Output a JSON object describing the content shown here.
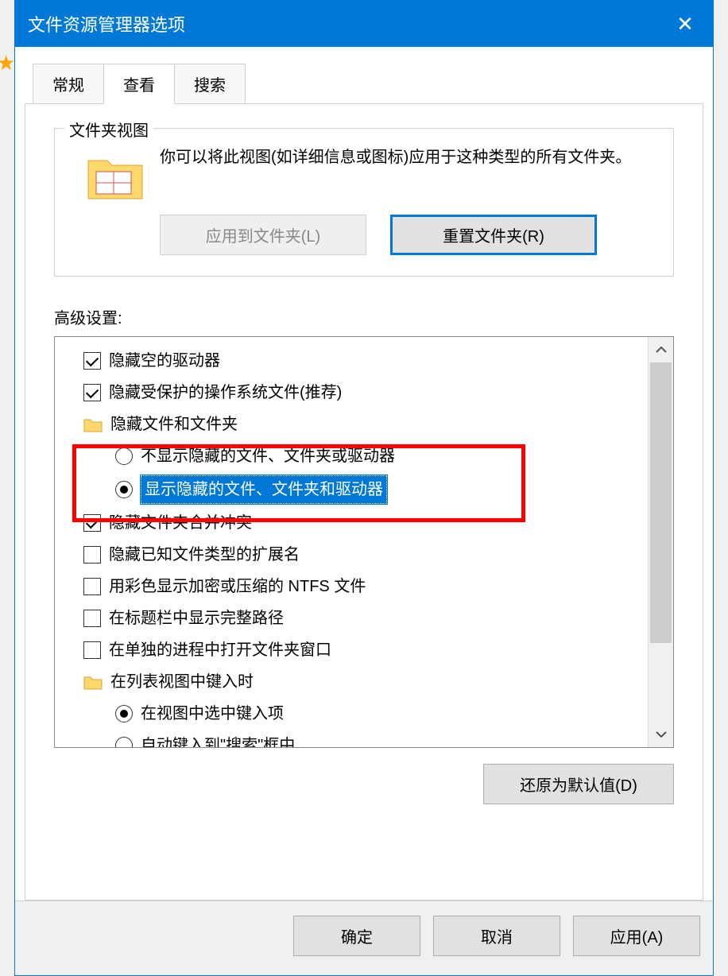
{
  "title": "文件资源管理器选项",
  "tabs": {
    "general": "常规",
    "view": "查看",
    "search": "搜索"
  },
  "folderView": {
    "legend": "文件夹视图",
    "desc": "你可以将此视图(如详细信息或图标)应用于这种类型的所有文件夹。",
    "applyBtn": "应用到文件夹(L)",
    "resetBtn": "重置文件夹(R)"
  },
  "advLabel": "高级设置:",
  "tree": {
    "hideEmptyDrives": "隐藏空的驱动器",
    "hideProtected": "隐藏受保护的操作系统文件(推荐)",
    "hiddenFilesFolder": "隐藏文件和文件夹",
    "dontShowHidden": "不显示隐藏的文件、文件夹或驱动器",
    "showHidden": "显示隐藏的文件、文件夹和驱动器",
    "hideMergeConflicts": "隐藏文件夹合并冲突",
    "hideKnownExt": "隐藏已知文件类型的扩展名",
    "colorNtfs": "用彩色显示加密或压缩的 NTFS 文件",
    "fullPathTitle": "在标题栏中显示完整路径",
    "separateProcess": "在单独的进程中打开文件夹窗口",
    "typeInListView": "在列表视图中键入时",
    "selectTyped": "在视图中选中键入项",
    "autoType": "自动键入到\"搜索\"框中"
  },
  "restoreDefaults": "还原为默认值(D)",
  "buttons": {
    "ok": "确定",
    "cancel": "取消",
    "apply": "应用(A)"
  }
}
